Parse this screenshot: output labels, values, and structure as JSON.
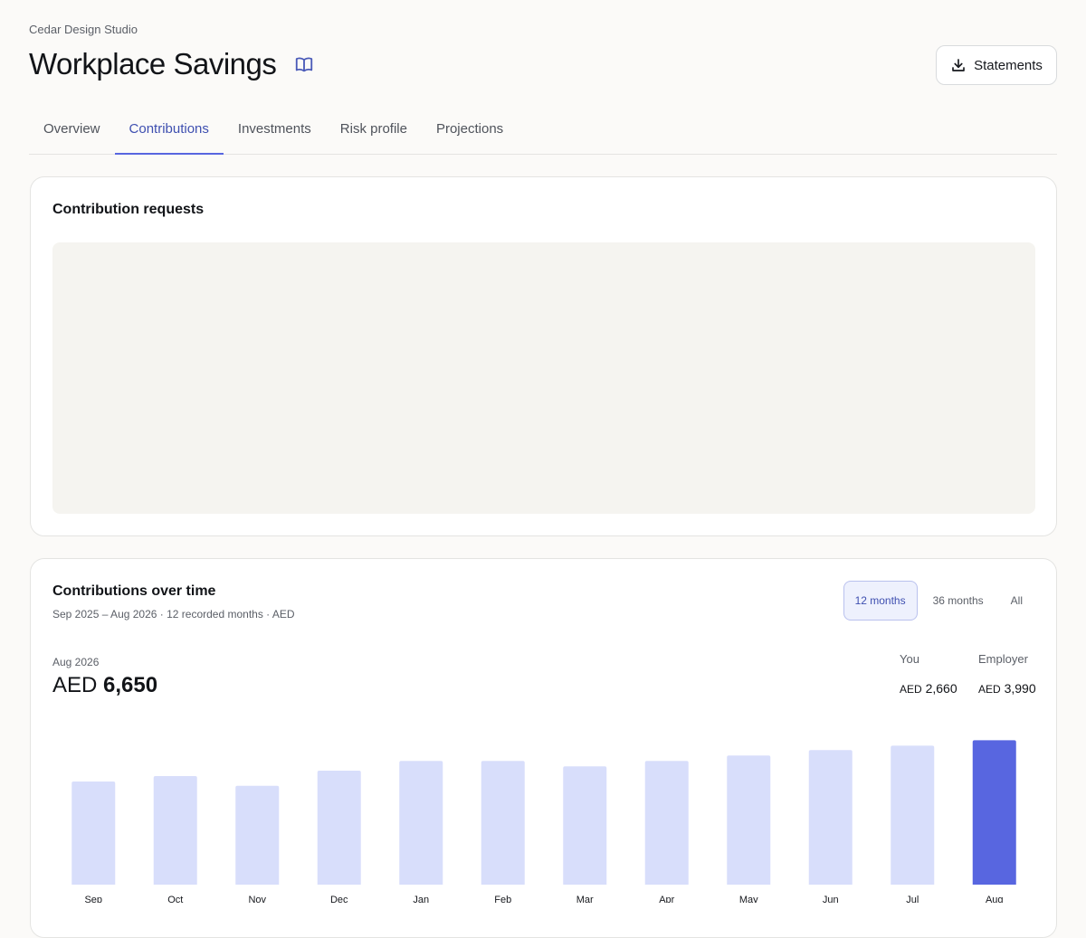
{
  "header": {
    "org": "Cedar Design Studio",
    "title": "Workplace Savings",
    "statements_label": "Statements"
  },
  "tabs": [
    {
      "label": "Overview"
    },
    {
      "label": "Contributions"
    },
    {
      "label": "Investments"
    },
    {
      "label": "Risk profile"
    },
    {
      "label": "Projections"
    }
  ],
  "active_tab": "Contributions",
  "requests_card": {
    "title": "Contribution requests"
  },
  "contrib_card": {
    "title": "Contributions over time",
    "subtitle": "Sep 2025 – Aug 2026 · 12 recorded months · AED",
    "ranges": [
      {
        "label": "12 months"
      },
      {
        "label": "36 months"
      },
      {
        "label": "All"
      }
    ],
    "active_range": "12 months",
    "period": "Aug 2026",
    "total_currency": "AED",
    "total_value": "6,650",
    "you_label": "You",
    "you_currency": "AED",
    "you_value": "2,660",
    "employer_label": "Employer",
    "employer_currency": "AED",
    "employer_value": "3,990"
  },
  "colors": {
    "accent": "#5866e0",
    "bar": "#d8defb",
    "bar_highlight": "#5866e0"
  },
  "icons": {
    "book": "book-open-icon",
    "download": "download-icon"
  },
  "chart_data": {
    "type": "bar",
    "categories": [
      "Sep",
      "Oct",
      "Nov",
      "Dec",
      "Jan",
      "Feb",
      "Mar",
      "Apr",
      "May",
      "Jun",
      "Jul",
      "Aug"
    ],
    "values": [
      4750,
      5000,
      4550,
      5250,
      5700,
      5700,
      5450,
      5700,
      5950,
      6200,
      6400,
      6650
    ],
    "highlight_index": 11,
    "ylim": [
      0,
      7000
    ],
    "grid": false,
    "title": "",
    "xlabel": "",
    "ylabel": ""
  }
}
